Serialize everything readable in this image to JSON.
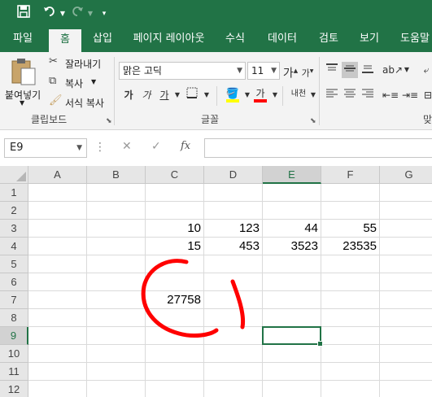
{
  "qat": {
    "save_icon": "save-icon",
    "undo_icon": "undo-icon",
    "redo_icon": "redo-icon",
    "customize_icon": "customize-qat-icon"
  },
  "tabs": [
    {
      "label": "파일"
    },
    {
      "label": "홈",
      "active": true
    },
    {
      "label": "삽입"
    },
    {
      "label": "페이지 레이아웃"
    },
    {
      "label": "수식"
    },
    {
      "label": "데이터"
    },
    {
      "label": "검토"
    },
    {
      "label": "보기"
    },
    {
      "label": "도움말"
    }
  ],
  "ribbon": {
    "clipboard": {
      "paste_label": "붙여넣기",
      "cut_label": "잘라내기",
      "copy_label": "복사",
      "format_painter_label": "서식 복사",
      "group_label": "클립보드"
    },
    "font": {
      "font_name": "맑은 고딕",
      "font_size": "11",
      "group_label": "글꼴",
      "bold": "가",
      "italic": "가",
      "underline": "가",
      "grow": "가",
      "shrink": "가",
      "font_color_letter": "가",
      "phonetic": "내천",
      "fill_color": "#ffff00",
      "font_color": "#ff0000"
    },
    "alignment": {
      "group_label": "맞"
    }
  },
  "formula_bar": {
    "name_box": "E9",
    "fx_label": "fx",
    "formula": ""
  },
  "grid": {
    "columns": [
      "A",
      "B",
      "C",
      "D",
      "E",
      "F",
      "G"
    ],
    "selected_column": "E",
    "rows": [
      "1",
      "2",
      "3",
      "4",
      "5",
      "6",
      "7",
      "8",
      "9",
      "10",
      "11",
      "12"
    ],
    "selected_row": "9",
    "cells": {
      "C3": "10",
      "D3": "123",
      "E3": "44",
      "F3": "55",
      "C4": "15",
      "D4": "453",
      "E4": "3523",
      "F4": "23535",
      "C7": "27758"
    },
    "selected_cell": "E9",
    "annotation_color": "#ff0000"
  }
}
